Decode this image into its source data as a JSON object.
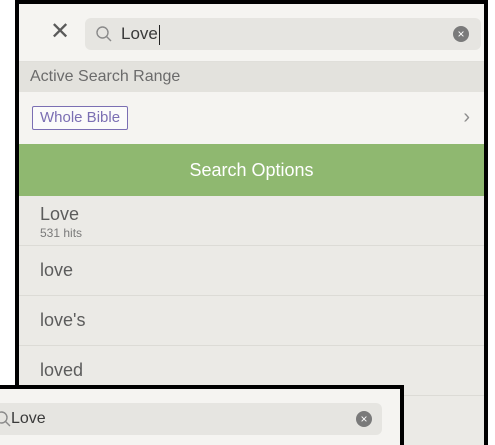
{
  "search": {
    "query": "Love",
    "close_glyph": "✕",
    "clear_glyph": "×"
  },
  "range": {
    "header": "Active Search Range",
    "selected": "Whole Bible",
    "chevron": "›"
  },
  "options": {
    "label": "Search Options"
  },
  "results": [
    {
      "word": "Love",
      "hits": "531 hits"
    },
    {
      "word": "love"
    },
    {
      "word": "love's"
    },
    {
      "word": "loved"
    }
  ],
  "overlay": {
    "query": "Love",
    "clear_glyph": "×"
  },
  "colors": {
    "accent_green": "#8fb870",
    "badge_purple": "#7b6fb3"
  }
}
